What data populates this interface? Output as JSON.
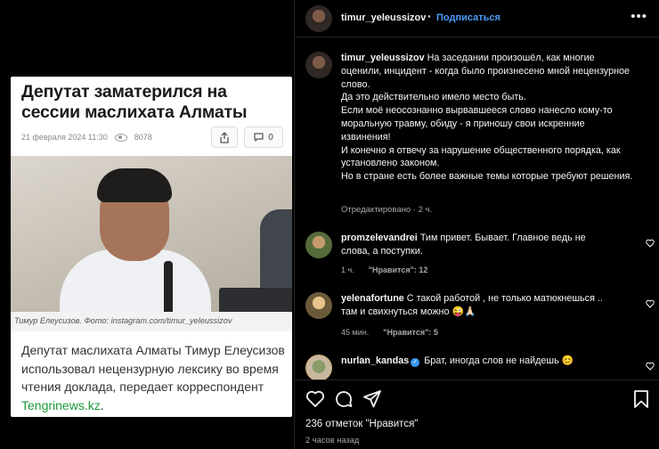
{
  "article": {
    "title": "Депутат заматерился на сессии маслихата Алматы",
    "date": "21 февраля 2024 11:30",
    "views": "8078",
    "comments": "0",
    "photo_caption": "Тимур Елеусизов. Фото: instagram.com/timur_yeleussizov",
    "body": "Депутат маслихата Алматы Тимур Елеусизов использовал нецензурную лексику во время чтения доклада, передает корреспондент ",
    "body_link": "Tengrinews.kz",
    "body_end": "."
  },
  "header": {
    "username": "timur_yeleussizov",
    "separator": "•",
    "follow_label": "Подписаться",
    "more": "•••"
  },
  "post_caption": {
    "username": "timur_yeleussizov",
    "text": "На заседании произошёл, как многие оценили, инцидент - когда было произнесено мной нецензурное слово.\nДа это действительно имело место быть.\nЕсли моё неосознанно вырвавшееся слово нанесло кому-то моральную травму, обиду - я приношу свои искренние извинения!\nИ конечно я отвечу за нарушение общественного порядка, как установлено законом.\nНо в стране есть более важные темы которые требуют решения.",
    "edited": "Отредактировано · 2 ч."
  },
  "comments": [
    {
      "username": "promzelevandrei",
      "text": "Тим привет. Бывает. Главное ведь не слова, а поступки.",
      "time": "1 ч.",
      "likes": "\"Нравится\": 12"
    },
    {
      "username": "yelenafortune",
      "text": "С такой работой , не только матюкнешься .. там и свихнуться можно 😜🙏🏻",
      "time": "45 мин.",
      "likes": "\"Нравится\": 5"
    },
    {
      "username": "nurlan_kandas",
      "verified": "✓",
      "text": "Брат, иногда слов не найдешь 😊",
      "time": "",
      "likes": ""
    }
  ],
  "footer": {
    "likes": "236 отметок \"Нравится\"",
    "time": "2 часов назад"
  },
  "icons": {
    "heart": "heart-icon",
    "comment": "comment-icon",
    "share": "share-icon",
    "save": "bookmark-icon",
    "more": "more-icon"
  },
  "colors": {
    "follow": "#4a9df8",
    "link": "#1a9b3a",
    "verified": "#3897f0"
  }
}
